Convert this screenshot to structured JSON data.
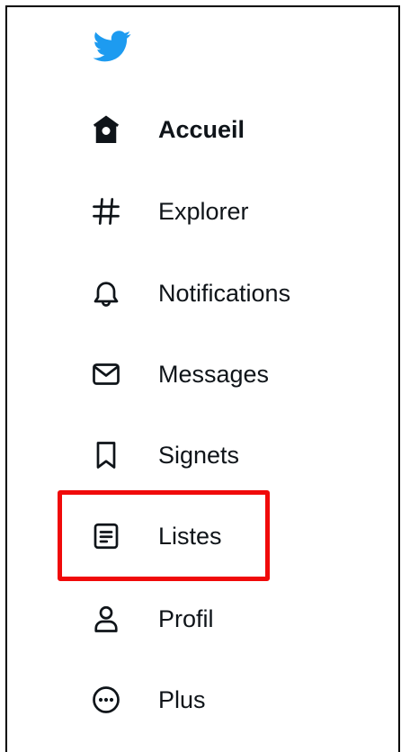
{
  "brand": {
    "icon": "twitter-bird-icon",
    "color": "#1d9bf0"
  },
  "nav": {
    "items": [
      {
        "key": "home",
        "label": "Accueil",
        "icon": "home-icon",
        "active": true
      },
      {
        "key": "explore",
        "label": "Explorer",
        "icon": "hashtag-icon",
        "active": false
      },
      {
        "key": "notifications",
        "label": "Notifications",
        "icon": "bell-icon",
        "active": false
      },
      {
        "key": "messages",
        "label": "Messages",
        "icon": "envelope-icon",
        "active": false
      },
      {
        "key": "bookmarks",
        "label": "Signets",
        "icon": "bookmark-icon",
        "active": false
      },
      {
        "key": "lists",
        "label": "Listes",
        "icon": "list-icon",
        "active": false,
        "highlighted": true
      },
      {
        "key": "profile",
        "label": "Profil",
        "icon": "user-icon",
        "active": false
      },
      {
        "key": "more",
        "label": "Plus",
        "icon": "more-circle-icon",
        "active": false
      }
    ]
  },
  "highlight": {
    "color": "#f00a0a",
    "target": "lists"
  }
}
